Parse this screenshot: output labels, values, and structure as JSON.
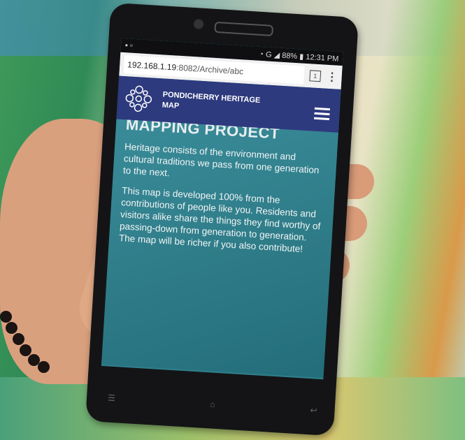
{
  "status_bar": {
    "time": "12:31 PM",
    "battery": "88%",
    "network": "G"
  },
  "browser": {
    "url_host": "192.168.1.19",
    "url_path": ":8082/Archive/abc",
    "tab_count": "1"
  },
  "site": {
    "title": "PONDICHERRY HERITAGE MAP"
  },
  "content": {
    "heading": "MAPPING PROJECT",
    "paragraphs": [
      "Heritage consists of the environment and cultural traditions we pass from one generation to the next.",
      "This map is developed 100% from the contributions of people like you.  Residents and visitors alike share the things they find worthy of passing-down from generation to generation. The map will be richer if you also contribute!"
    ]
  },
  "colors": {
    "header": "#2e3a7e",
    "content_bg": "#2f7f8c"
  }
}
